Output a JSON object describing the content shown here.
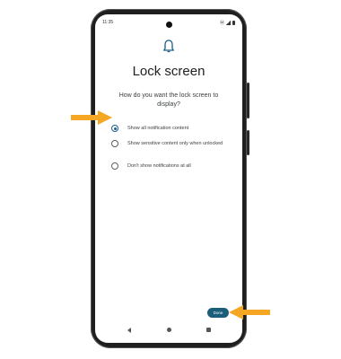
{
  "status_bar": {
    "time": "11:35",
    "right_icons": "Ⓜ"
  },
  "icons": {
    "header": "bell-icon",
    "arrows": "arrow-right-icon"
  },
  "screen": {
    "title": "Lock screen",
    "question": "How do you want the lock screen to display?",
    "options": [
      {
        "label": "Show all notification content",
        "selected": true
      },
      {
        "label": "Show sensitive content only when unlocked",
        "selected": false
      },
      {
        "label": "Don't show notifications at all",
        "selected": false
      }
    ],
    "done_label": "Done"
  },
  "colors": {
    "accent": "#1b5e8a",
    "button": "#1b5e7a",
    "arrow": "#f5a623"
  }
}
